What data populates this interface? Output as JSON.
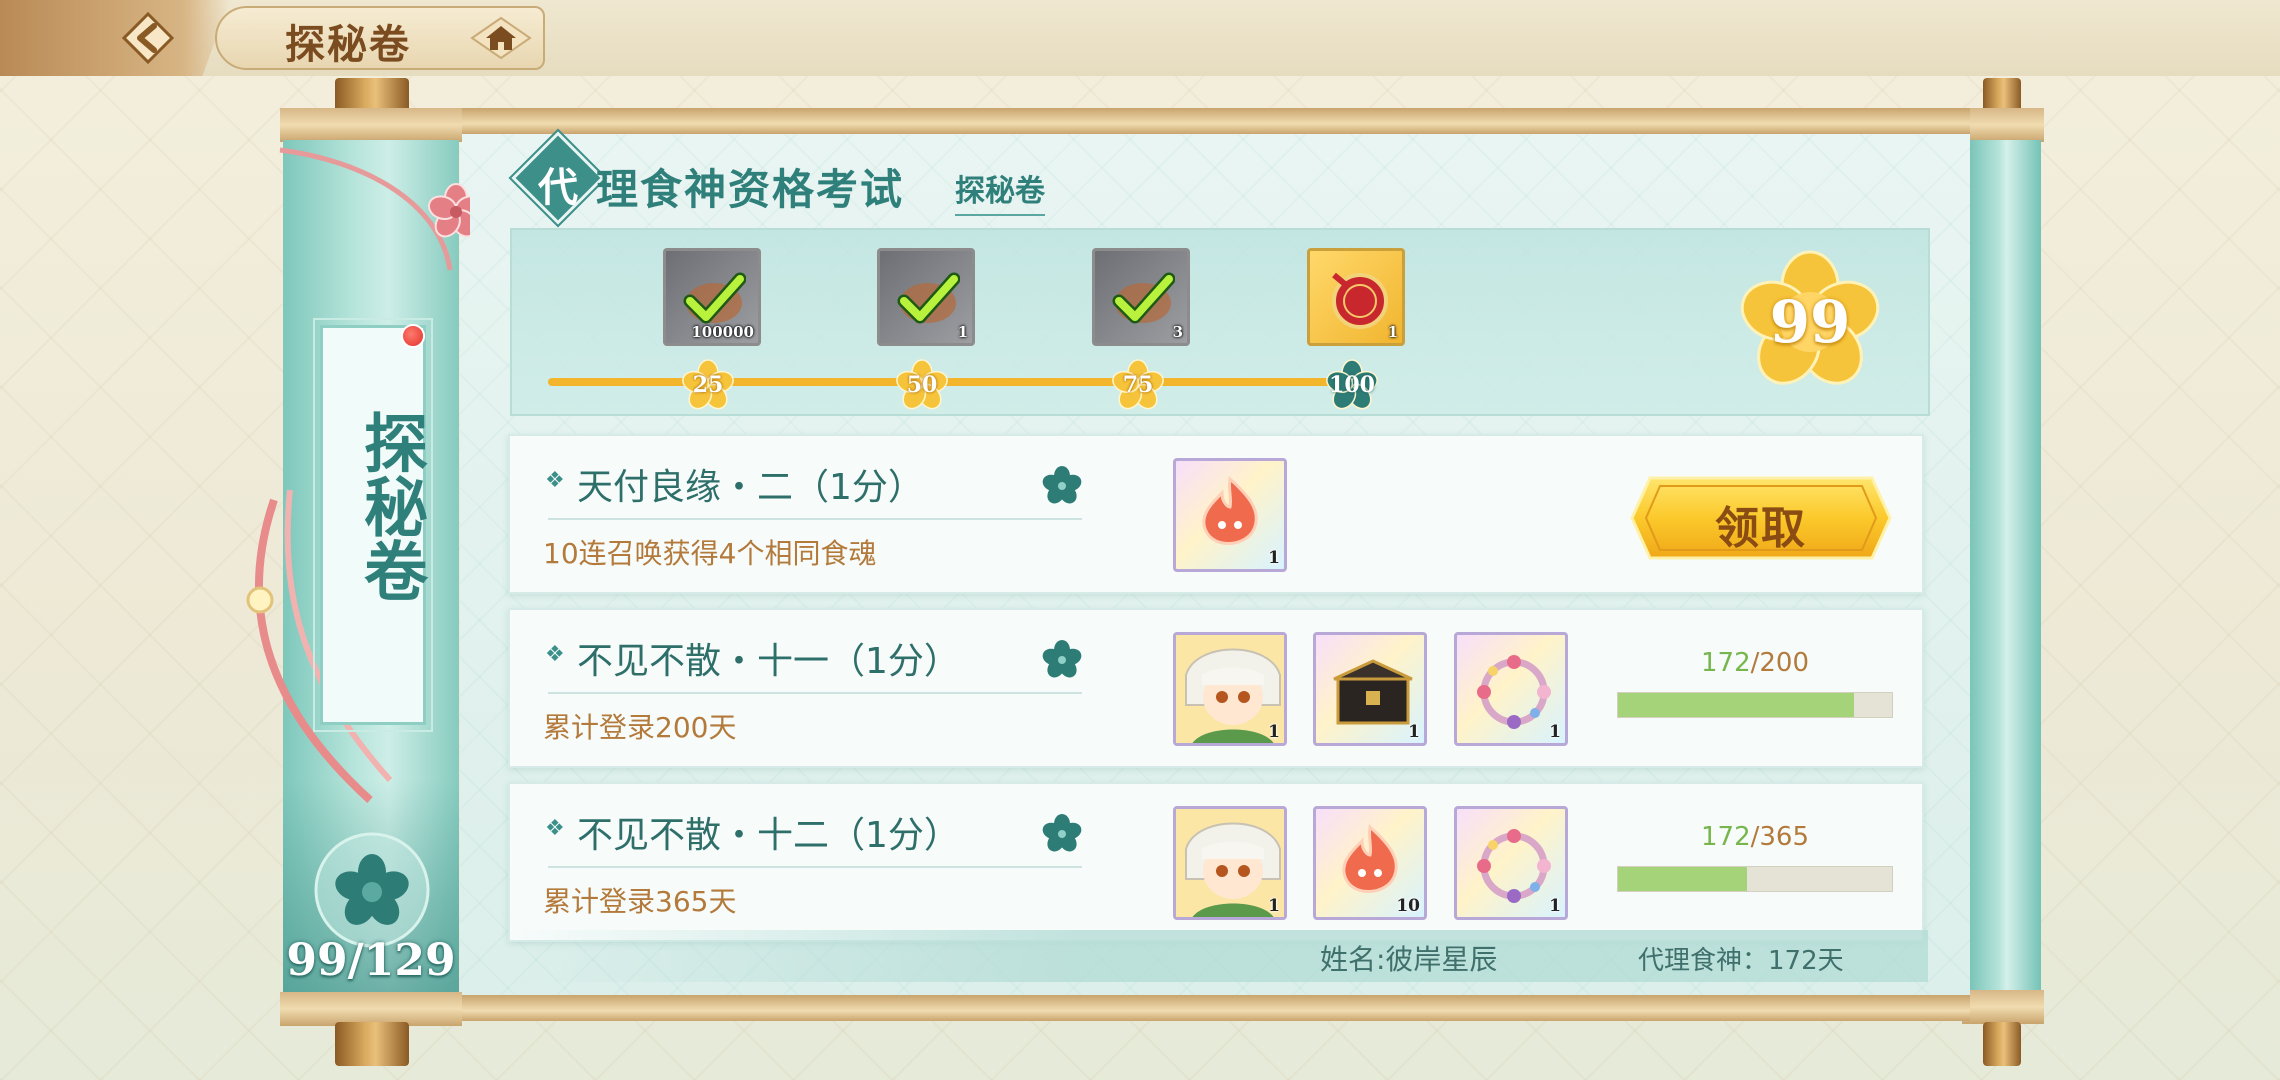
{
  "header": {
    "title": "探秘卷"
  },
  "exam": {
    "first_char": "代",
    "title_rest": "理食神资格考试",
    "subtitle": "探秘卷"
  },
  "milestones": {
    "points": [
      "25",
      "50",
      "75",
      "100"
    ],
    "rewards": [
      {
        "qty": "100000",
        "icon": "check-icon",
        "claimed": true
      },
      {
        "qty": "1",
        "icon": "check-icon",
        "claimed": true
      },
      {
        "qty": "3",
        "icon": "check-icon",
        "claimed": true
      },
      {
        "qty": "1",
        "icon": "seal-icon",
        "claimed": false
      }
    ],
    "score": "99",
    "track_progress": 1.0
  },
  "tasks": [
    {
      "title": "天付良缘・二（1分）",
      "desc": "10连召唤获得4个相同食魂",
      "rewards": [
        {
          "icon": "spirit-flame-icon",
          "qty": "1"
        }
      ],
      "action": "领取"
    },
    {
      "title": "不见不散・十一（1分）",
      "desc": "累计登录200天",
      "rewards": [
        {
          "icon": "character-avatar-icon",
          "qty": "1"
        },
        {
          "icon": "treasure-box-icon",
          "qty": "1"
        },
        {
          "icon": "flower-wreath-icon",
          "qty": "1"
        }
      ],
      "progress_current": "172",
      "progress_total": "/200",
      "progress_fraction": 0.86
    },
    {
      "title": "不见不散・十二（1分）",
      "desc": "累计登录365天",
      "rewards": [
        {
          "icon": "character-avatar-icon",
          "qty": "1"
        },
        {
          "icon": "spirit-flame-icon",
          "qty": "10"
        },
        {
          "icon": "flower-wreath-icon",
          "qty": "1"
        }
      ],
      "progress_current": "172",
      "progress_total": "/365",
      "progress_fraction": 0.471
    }
  ],
  "footer": {
    "name": "姓名:彼岸星辰",
    "days": "代理食神：172天"
  },
  "side": {
    "label": "探秘卷",
    "count": "99/129"
  },
  "colors": {
    "teal": "#2f7f7a",
    "gold": "#f2b52c",
    "progress_green": "#a4d37a",
    "desc_brown": "#b37a3b"
  }
}
